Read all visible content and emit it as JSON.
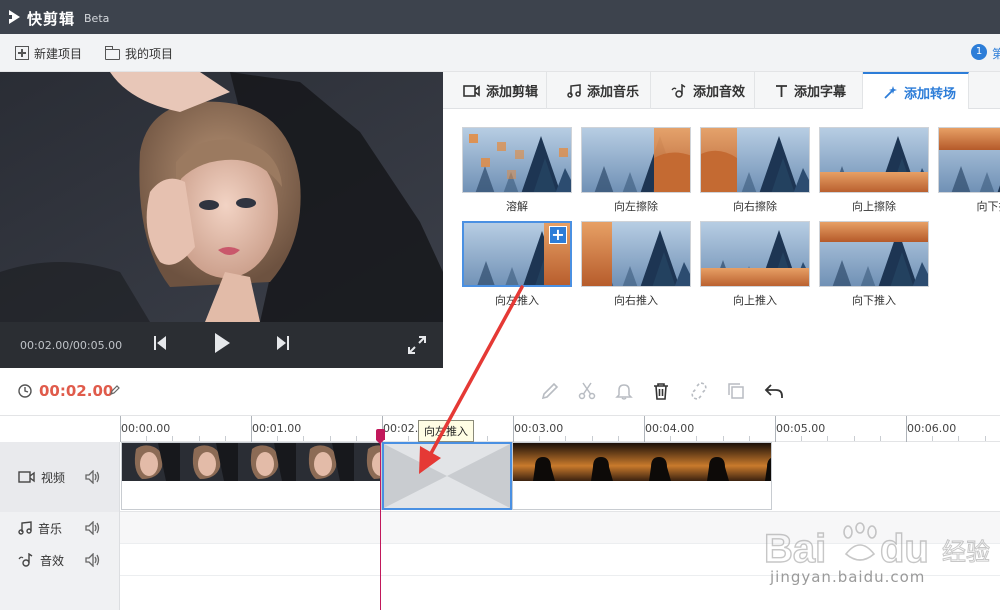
{
  "app": {
    "title": "快剪辑",
    "badge": "Beta"
  },
  "toolbar": {
    "new_project": "新建项目",
    "my_project": "我的项目",
    "notify_count": "1",
    "notify_text": "第"
  },
  "player": {
    "time": "00:02.00/00:05.00"
  },
  "tabs": [
    {
      "label": "添加剪辑",
      "icon": "video-camera-icon"
    },
    {
      "label": "添加音乐",
      "icon": "music-note-icon"
    },
    {
      "label": "添加音效",
      "icon": "sound-effect-icon"
    },
    {
      "label": "添加字幕",
      "icon": "text-t-icon"
    },
    {
      "label": "添加转场",
      "icon": "magic-wand-icon",
      "active": true
    }
  ],
  "transitions": [
    {
      "label": "溶解"
    },
    {
      "label": "向左擦除"
    },
    {
      "label": "向右擦除"
    },
    {
      "label": "向上擦除"
    },
    {
      "label": "向下擦"
    },
    {
      "label": "向左推入",
      "selected": true
    },
    {
      "label": "向右推入"
    },
    {
      "label": "向上推入"
    },
    {
      "label": "向下推入"
    }
  ],
  "editbar": {
    "timecode": "00:02.00"
  },
  "ruler": {
    "ticks": [
      "00:00.00",
      "00:01.00",
      "00:02.0",
      "00:03.00",
      "00:04.00",
      "00:05.00",
      "00:06.00"
    ]
  },
  "tracks": {
    "video": "视频",
    "music": "音乐",
    "sfx": "音效"
  },
  "tooltip": "向左推入",
  "watermark": {
    "text": "jingyan.baidu.com"
  },
  "colors": {
    "accent": "#2d7dd8",
    "playhead": "#c2185b",
    "timecode": "#e05b4b",
    "arrow": "#e53935"
  }
}
